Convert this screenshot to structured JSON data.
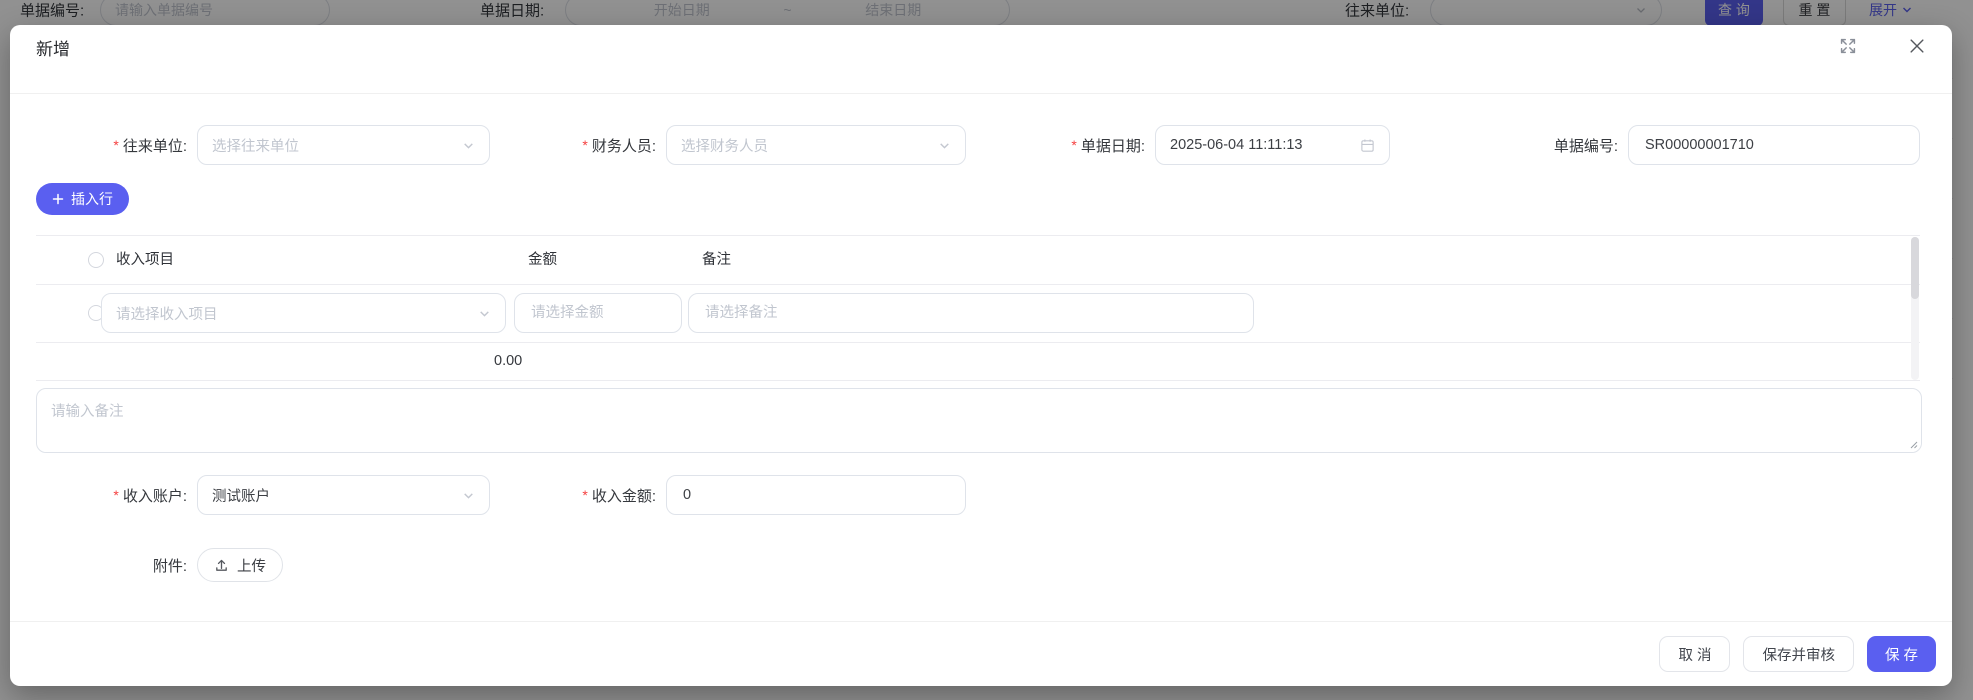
{
  "background": {
    "filter": {
      "doc_no_label": "单据编号:",
      "doc_no_placeholder": "请输入单据编号",
      "date_label": "单据日期:",
      "date_start_placeholder": "开始日期",
      "date_separator": "~",
      "date_end_placeholder": "结束日期",
      "partner_label": "往来单位:",
      "search_button": "查 询",
      "reset_button": "重 置",
      "expand_link": "展开"
    }
  },
  "modal": {
    "title": "新增",
    "required_mark": "*",
    "fields": {
      "partner": {
        "label": "往来单位:",
        "placeholder": "选择往来单位"
      },
      "finance_staff": {
        "label": "财务人员:",
        "placeholder": "选择财务人员"
      },
      "doc_date": {
        "label": "单据日期:",
        "value": "2025-06-04 11:11:13"
      },
      "doc_no": {
        "label": "单据编号:",
        "value": "SR00000001710"
      },
      "income_account": {
        "label": "收入账户:",
        "value": "测试账户"
      },
      "income_amount": {
        "label": "收入金额:",
        "value": "0"
      },
      "attachment": {
        "label": "附件:",
        "upload_button": "上传"
      },
      "remark_placeholder": "请输入备注"
    },
    "insert_row_button": "插入行",
    "items_table": {
      "columns": {
        "item": "收入项目",
        "amount": "金额",
        "remark": "备注"
      },
      "row": {
        "item_placeholder": "请选择收入项目",
        "amount_placeholder": "请选择金额",
        "remark_placeholder": "请选择备注"
      },
      "total_amount": "0.00"
    },
    "footer": {
      "cancel_button": "取 消",
      "save_audit_button": "保存并审核",
      "save_button": "保 存"
    }
  },
  "colors": {
    "primary": "#5A5FF0",
    "required": "#F53F3F",
    "mask": "rgba(0,0,0,0.43)"
  }
}
